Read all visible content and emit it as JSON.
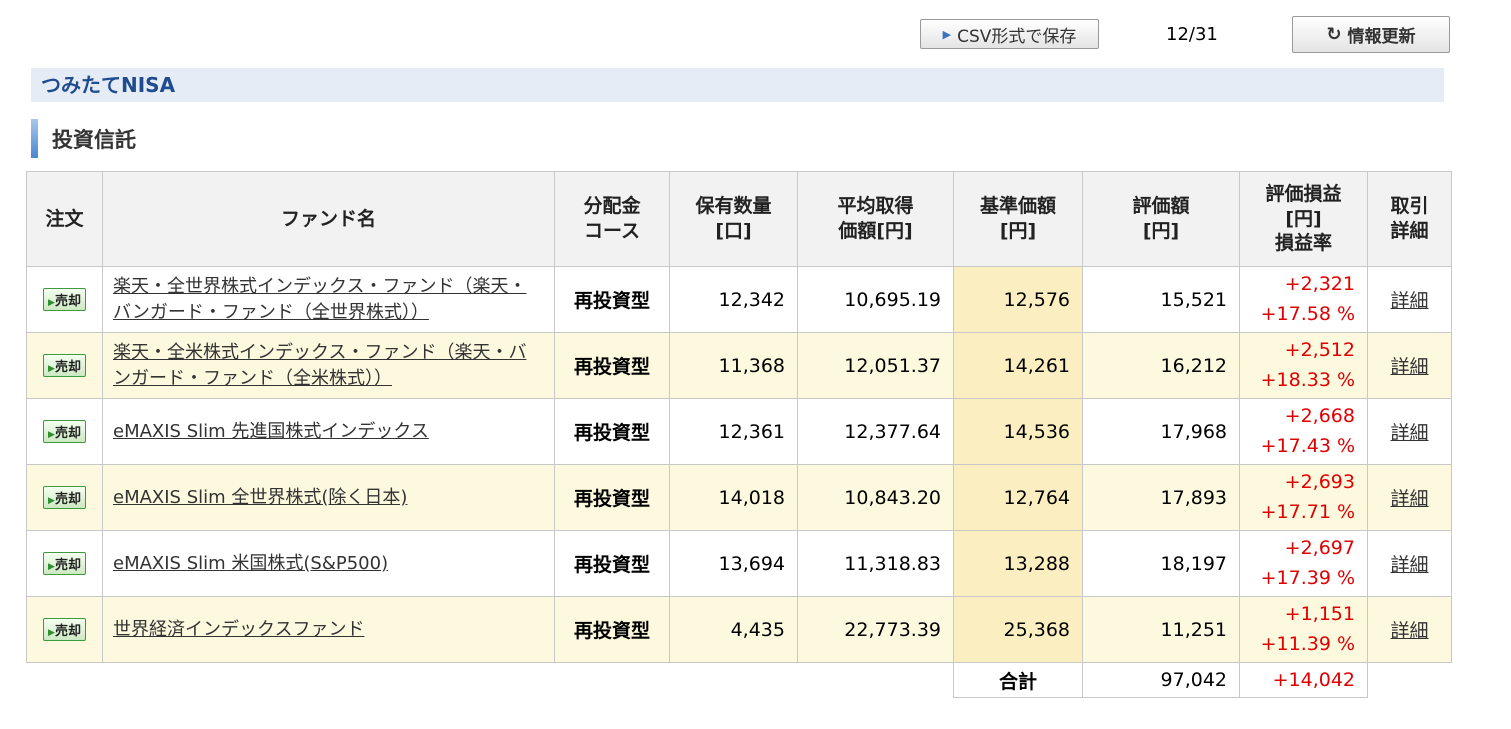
{
  "toolbar": {
    "csv_label": "CSV形式で保存",
    "date": "12/31",
    "refresh_label": "情報更新"
  },
  "section_title": "つみたてNISA",
  "subsection_title": "投資信託",
  "table": {
    "headers": {
      "order": "注文",
      "fund": "ファンド名",
      "dist_1": "分配金",
      "dist_2": "コース",
      "qty_1": "保有数量",
      "qty_2": "[口]",
      "avg_1": "平均取得",
      "avg_2": "価額[円]",
      "nav_1": "基準価額",
      "nav_2": "[円]",
      "value_1": "評価額",
      "value_2": "[円]",
      "pl_1": "評価損益",
      "pl_2": "[円]",
      "pl_3": "損益率",
      "detail_1": "取引",
      "detail_2": "詳細"
    },
    "sell_label": "売却",
    "rows": [
      {
        "fund": "楽天・全世界株式インデックス・ファンド（楽天・バンガード・ファンド（全世界株式））",
        "dist": "再投資型",
        "qty": "12,342",
        "avg": "10,695.19",
        "nav": "12,576",
        "value": "15,521",
        "pl": "+2,321",
        "rate": "+17.58 %",
        "detail": "詳細"
      },
      {
        "fund": "楽天・全米株式インデックス・ファンド（楽天・バンガード・ファンド（全米株式））",
        "dist": "再投資型",
        "qty": "11,368",
        "avg": "12,051.37",
        "nav": "14,261",
        "value": "16,212",
        "pl": "+2,512",
        "rate": "+18.33 %",
        "detail": "詳細"
      },
      {
        "fund": "eMAXIS Slim 先進国株式インデックス",
        "dist": "再投資型",
        "qty": "12,361",
        "avg": "12,377.64",
        "nav": "14,536",
        "value": "17,968",
        "pl": "+2,668",
        "rate": "+17.43 %",
        "detail": "詳細"
      },
      {
        "fund": "eMAXIS Slim 全世界株式(除く日本)",
        "dist": "再投資型",
        "qty": "14,018",
        "avg": "10,843.20",
        "nav": "12,764",
        "value": "17,893",
        "pl": "+2,693",
        "rate": "+17.71 %",
        "detail": "詳細"
      },
      {
        "fund": "eMAXIS Slim 米国株式(S&P500)",
        "dist": "再投資型",
        "qty": "13,694",
        "avg": "11,318.83",
        "nav": "13,288",
        "value": "18,197",
        "pl": "+2,697",
        "rate": "+17.39 %",
        "detail": "詳細"
      },
      {
        "fund": "世界経済インデックスファンド",
        "dist": "再投資型",
        "qty": "4,435",
        "avg": "22,773.39",
        "nav": "25,368",
        "value": "11,251",
        "pl": "+1,151",
        "rate": "+11.39 %",
        "detail": "詳細"
      }
    ],
    "total": {
      "label": "合計",
      "value": "97,042",
      "pl": "+14,042"
    }
  },
  "colors": {
    "section_text": "#1f4b91",
    "section_bg": "#e6ecf5",
    "alt_row": "#fdf9df",
    "nav_col": "#fbefc1",
    "profit": "#e00000"
  },
  "icons": [
    "play-triangle-icon",
    "refresh-icon",
    "sell-arrow-icon"
  ]
}
